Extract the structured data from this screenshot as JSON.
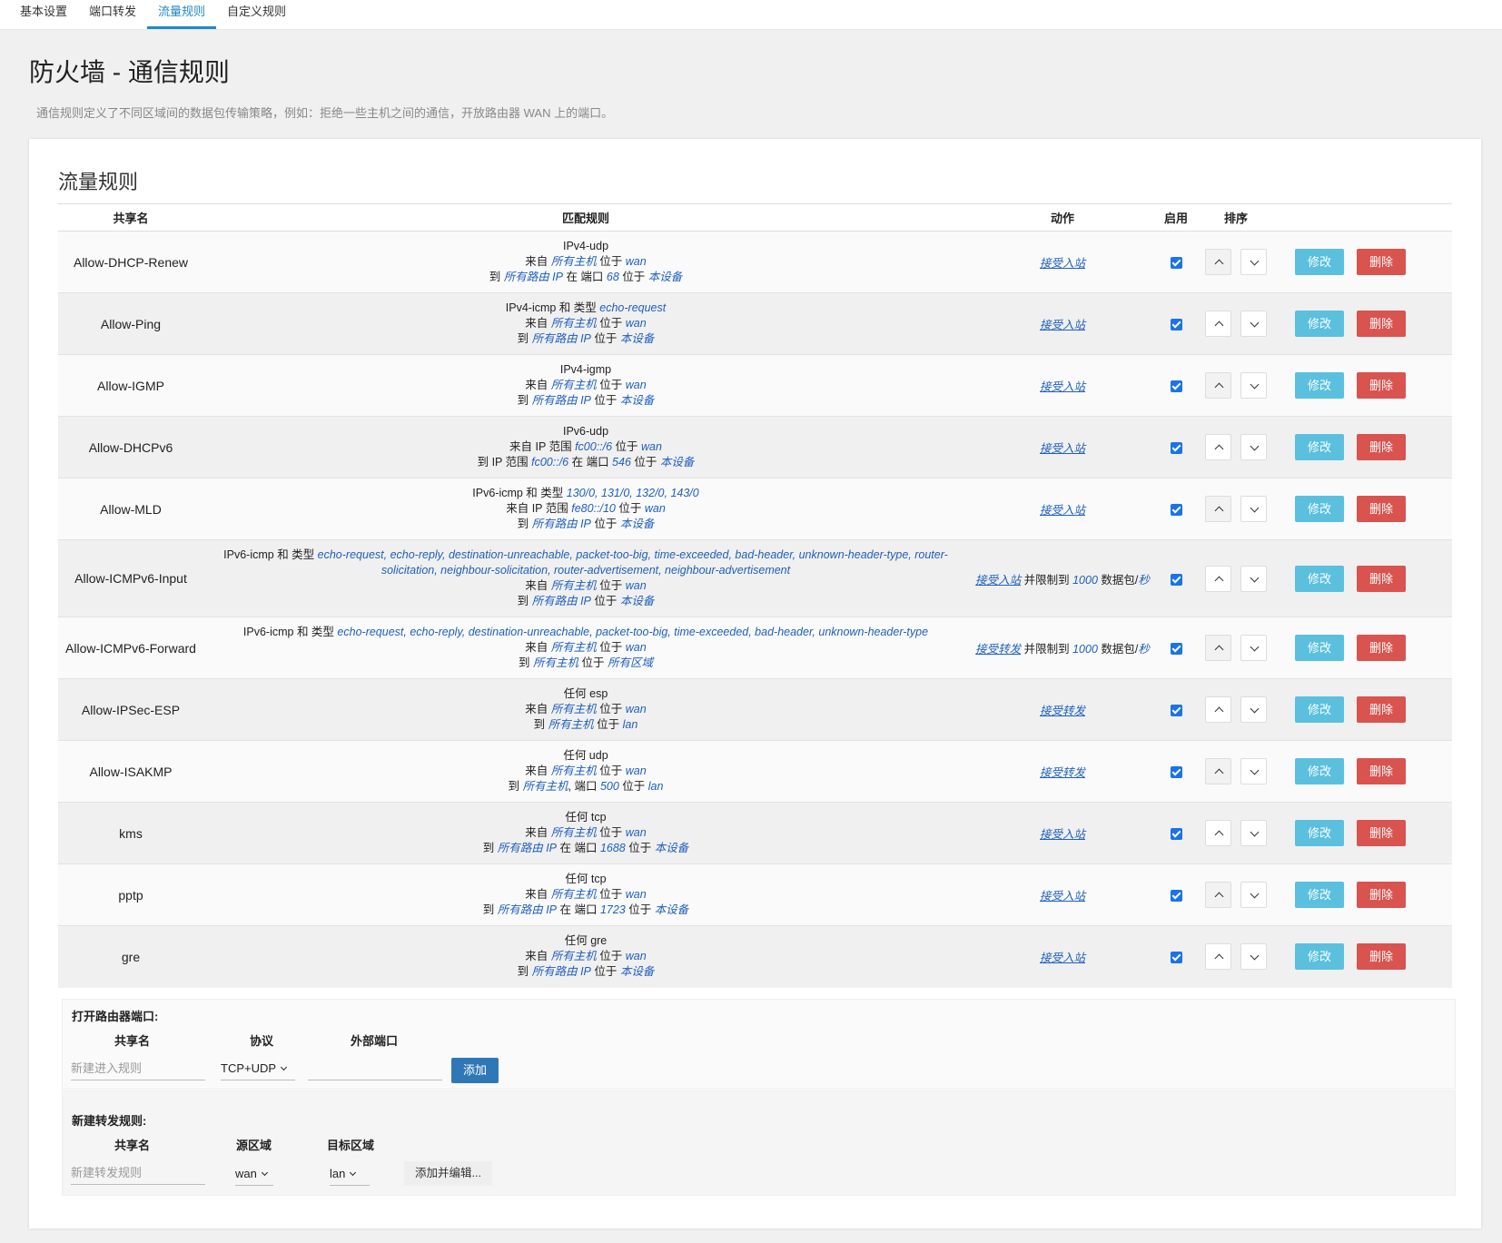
{
  "tabs": [
    {
      "label": "基本设置",
      "active": false
    },
    {
      "label": "端口转发",
      "active": false
    },
    {
      "label": "流量规则",
      "active": true
    },
    {
      "label": "自定义规则",
      "active": false
    }
  ],
  "page": {
    "title": "防火墙 - 通信规则",
    "description": "通信规则定义了不同区域间的数据包传输策略，例如：拒绝一些主机之间的通信，开放路由器 WAN 上的端口。"
  },
  "section_title": "流量规则",
  "table": {
    "headers": [
      "共享名",
      "匹配规则",
      "动作",
      "启用",
      "排序"
    ],
    "edit_label": "修改",
    "delete_label": "删除",
    "rows": [
      {
        "name": "Allow-DHCP-Renew",
        "lines": [
          [
            {
              "t": "IPv4-udp"
            }
          ],
          [
            {
              "t": "来自 "
            },
            {
              "t": "所有主机",
              "i": true
            },
            {
              "t": " 位于 "
            },
            {
              "t": "wan",
              "i": true
            }
          ],
          [
            {
              "t": "到 "
            },
            {
              "t": "所有路由 IP",
              "i": true
            },
            {
              "t": " 在 端口 "
            },
            {
              "t": "68",
              "i": true
            },
            {
              "t": " 位于 "
            },
            {
              "t": "本设备",
              "i": true
            }
          ]
        ],
        "action": [
          {
            "t": "接受入站",
            "u": true
          }
        ],
        "enabled": true
      },
      {
        "name": "Allow-Ping",
        "lines": [
          [
            {
              "t": "IPv4-icmp 和 类型 "
            },
            {
              "t": "echo-request",
              "i": true
            }
          ],
          [
            {
              "t": "来自 "
            },
            {
              "t": "所有主机",
              "i": true
            },
            {
              "t": " 位于 "
            },
            {
              "t": "wan",
              "i": true
            }
          ],
          [
            {
              "t": "到 "
            },
            {
              "t": "所有路由 IP",
              "i": true
            },
            {
              "t": " 位于 "
            },
            {
              "t": "本设备",
              "i": true
            }
          ]
        ],
        "action": [
          {
            "t": "接受入站",
            "u": true
          }
        ],
        "enabled": true
      },
      {
        "name": "Allow-IGMP",
        "lines": [
          [
            {
              "t": "IPv4-igmp"
            }
          ],
          [
            {
              "t": "来自 "
            },
            {
              "t": "所有主机",
              "i": true
            },
            {
              "t": " 位于 "
            },
            {
              "t": "wan",
              "i": true
            }
          ],
          [
            {
              "t": "到 "
            },
            {
              "t": "所有路由 IP",
              "i": true
            },
            {
              "t": " 位于 "
            },
            {
              "t": "本设备",
              "i": true
            }
          ]
        ],
        "action": [
          {
            "t": "接受入站",
            "u": true
          }
        ],
        "enabled": true
      },
      {
        "name": "Allow-DHCPv6",
        "lines": [
          [
            {
              "t": "IPv6-udp"
            }
          ],
          [
            {
              "t": "来自 IP 范围 "
            },
            {
              "t": "fc00::/6",
              "i": true
            },
            {
              "t": " 位于 "
            },
            {
              "t": "wan",
              "i": true
            }
          ],
          [
            {
              "t": "到 IP 范围 "
            },
            {
              "t": "fc00::/6",
              "i": true
            },
            {
              "t": " 在 端口 "
            },
            {
              "t": "546",
              "i": true
            },
            {
              "t": " 位于 "
            },
            {
              "t": "本设备",
              "i": true
            }
          ]
        ],
        "action": [
          {
            "t": "接受入站",
            "u": true
          }
        ],
        "enabled": true
      },
      {
        "name": "Allow-MLD",
        "lines": [
          [
            {
              "t": "IPv6-icmp 和 类型 "
            },
            {
              "t": "130/0, 131/0, 132/0, 143/0",
              "i": true
            }
          ],
          [
            {
              "t": "来自 IP 范围 "
            },
            {
              "t": "fe80::/10",
              "i": true
            },
            {
              "t": " 位于 "
            },
            {
              "t": "wan",
              "i": true
            }
          ],
          [
            {
              "t": "到 "
            },
            {
              "t": "所有路由 IP",
              "i": true
            },
            {
              "t": " 位于 "
            },
            {
              "t": "本设备",
              "i": true
            }
          ]
        ],
        "action": [
          {
            "t": "接受入站",
            "u": true
          }
        ],
        "enabled": true
      },
      {
        "name": "Allow-ICMPv6-Input",
        "lines": [
          [
            {
              "t": "IPv6-icmp 和 类型 "
            },
            {
              "t": "echo-request, echo-reply, destination-unreachable, packet-too-big, time-exceeded, bad-header, unknown-header-type, router-solicitation, neighbour-solicitation, router-advertisement, neighbour-advertisement",
              "i": true
            }
          ],
          [
            {
              "t": "来自 "
            },
            {
              "t": "所有主机",
              "i": true
            },
            {
              "t": " 位于 "
            },
            {
              "t": "wan",
              "i": true
            }
          ],
          [
            {
              "t": "到 "
            },
            {
              "t": "所有路由 IP",
              "i": true
            },
            {
              "t": " 位于 "
            },
            {
              "t": "本设备",
              "i": true
            }
          ]
        ],
        "action": [
          {
            "t": "接受入站",
            "u": true
          },
          {
            "t": " 并限制到 "
          },
          {
            "t": "1000",
            "i": true
          },
          {
            "t": " 数据包/"
          },
          {
            "t": "秒",
            "i": true
          }
        ],
        "enabled": true
      },
      {
        "name": "Allow-ICMPv6-Forward",
        "lines": [
          [
            {
              "t": "IPv6-icmp 和 类型 "
            },
            {
              "t": "echo-request, echo-reply, destination-unreachable, packet-too-big, time-exceeded, bad-header, unknown-header-type",
              "i": true
            }
          ],
          [
            {
              "t": "来自 "
            },
            {
              "t": "所有主机",
              "i": true
            },
            {
              "t": " 位于 "
            },
            {
              "t": "wan",
              "i": true
            }
          ],
          [
            {
              "t": "到 "
            },
            {
              "t": "所有主机",
              "i": true
            },
            {
              "t": " 位于 "
            },
            {
              "t": "所有区域",
              "i": true
            }
          ]
        ],
        "action": [
          {
            "t": "接受转发",
            "u": true
          },
          {
            "t": " 并限制到 "
          },
          {
            "t": "1000",
            "i": true
          },
          {
            "t": " 数据包/"
          },
          {
            "t": "秒",
            "i": true
          }
        ],
        "enabled": true
      },
      {
        "name": "Allow-IPSec-ESP",
        "lines": [
          [
            {
              "t": "任何 esp"
            }
          ],
          [
            {
              "t": "来自 "
            },
            {
              "t": "所有主机",
              "i": true
            },
            {
              "t": " 位于 "
            },
            {
              "t": "wan",
              "i": true
            }
          ],
          [
            {
              "t": "到 "
            },
            {
              "t": "所有主机",
              "i": true
            },
            {
              "t": " 位于 "
            },
            {
              "t": "lan",
              "i": true
            }
          ]
        ],
        "action": [
          {
            "t": "接受转发",
            "u": true
          }
        ],
        "enabled": true
      },
      {
        "name": "Allow-ISAKMP",
        "lines": [
          [
            {
              "t": "任何 udp"
            }
          ],
          [
            {
              "t": "来自 "
            },
            {
              "t": "所有主机",
              "i": true
            },
            {
              "t": " 位于 "
            },
            {
              "t": "wan",
              "i": true
            }
          ],
          [
            {
              "t": "到 "
            },
            {
              "t": "所有主机",
              "i": true
            },
            {
              "t": ", 端口 "
            },
            {
              "t": "500",
              "i": true
            },
            {
              "t": " 位于 "
            },
            {
              "t": "lan",
              "i": true
            }
          ]
        ],
        "action": [
          {
            "t": "接受转发",
            "u": true
          }
        ],
        "enabled": true
      },
      {
        "name": "kms",
        "lines": [
          [
            {
              "t": "任何 tcp"
            }
          ],
          [
            {
              "t": "来自 "
            },
            {
              "t": "所有主机",
              "i": true
            },
            {
              "t": " 位于 "
            },
            {
              "t": "wan",
              "i": true
            }
          ],
          [
            {
              "t": "到 "
            },
            {
              "t": "所有路由 IP",
              "i": true
            },
            {
              "t": " 在 端口 "
            },
            {
              "t": "1688",
              "i": true
            },
            {
              "t": " 位于 "
            },
            {
              "t": "本设备",
              "i": true
            }
          ]
        ],
        "action": [
          {
            "t": "接受入站",
            "u": true
          }
        ],
        "enabled": true
      },
      {
        "name": "pptp",
        "lines": [
          [
            {
              "t": "任何 tcp"
            }
          ],
          [
            {
              "t": "来自 "
            },
            {
              "t": "所有主机",
              "i": true
            },
            {
              "t": " 位于 "
            },
            {
              "t": "wan",
              "i": true
            }
          ],
          [
            {
              "t": "到 "
            },
            {
              "t": "所有路由 IP",
              "i": true
            },
            {
              "t": " 在 端口 "
            },
            {
              "t": "1723",
              "i": true
            },
            {
              "t": " 位于 "
            },
            {
              "t": "本设备",
              "i": true
            }
          ]
        ],
        "action": [
          {
            "t": "接受入站",
            "u": true
          }
        ],
        "enabled": true
      },
      {
        "name": "gre",
        "lines": [
          [
            {
              "t": "任何 gre"
            }
          ],
          [
            {
              "t": "来自 "
            },
            {
              "t": "所有主机",
              "i": true
            },
            {
              "t": " 位于 "
            },
            {
              "t": "wan",
              "i": true
            }
          ],
          [
            {
              "t": "到 "
            },
            {
              "t": "所有路由 IP",
              "i": true
            },
            {
              "t": " 位于 "
            },
            {
              "t": "本设备",
              "i": true
            }
          ]
        ],
        "action": [
          {
            "t": "接受入站",
            "u": true
          }
        ],
        "enabled": true
      }
    ]
  },
  "open_ports": {
    "title": "打开路由器端口:",
    "col_name": "共享名",
    "col_protocol": "协议",
    "col_ext_port": "外部端口",
    "name_placeholder": "新建进入规则",
    "protocol_value": "TCP+UDP",
    "ext_port_value": "",
    "add_label": "添加"
  },
  "new_forward": {
    "title": "新建转发规则:",
    "col_name": "共享名",
    "col_src_zone": "源区域",
    "col_dst_zone": "目标区域",
    "name_placeholder": "新建转发规则",
    "src_zone_value": "wan",
    "dst_zone_value": "lan",
    "add_edit_label": "添加并编辑..."
  }
}
